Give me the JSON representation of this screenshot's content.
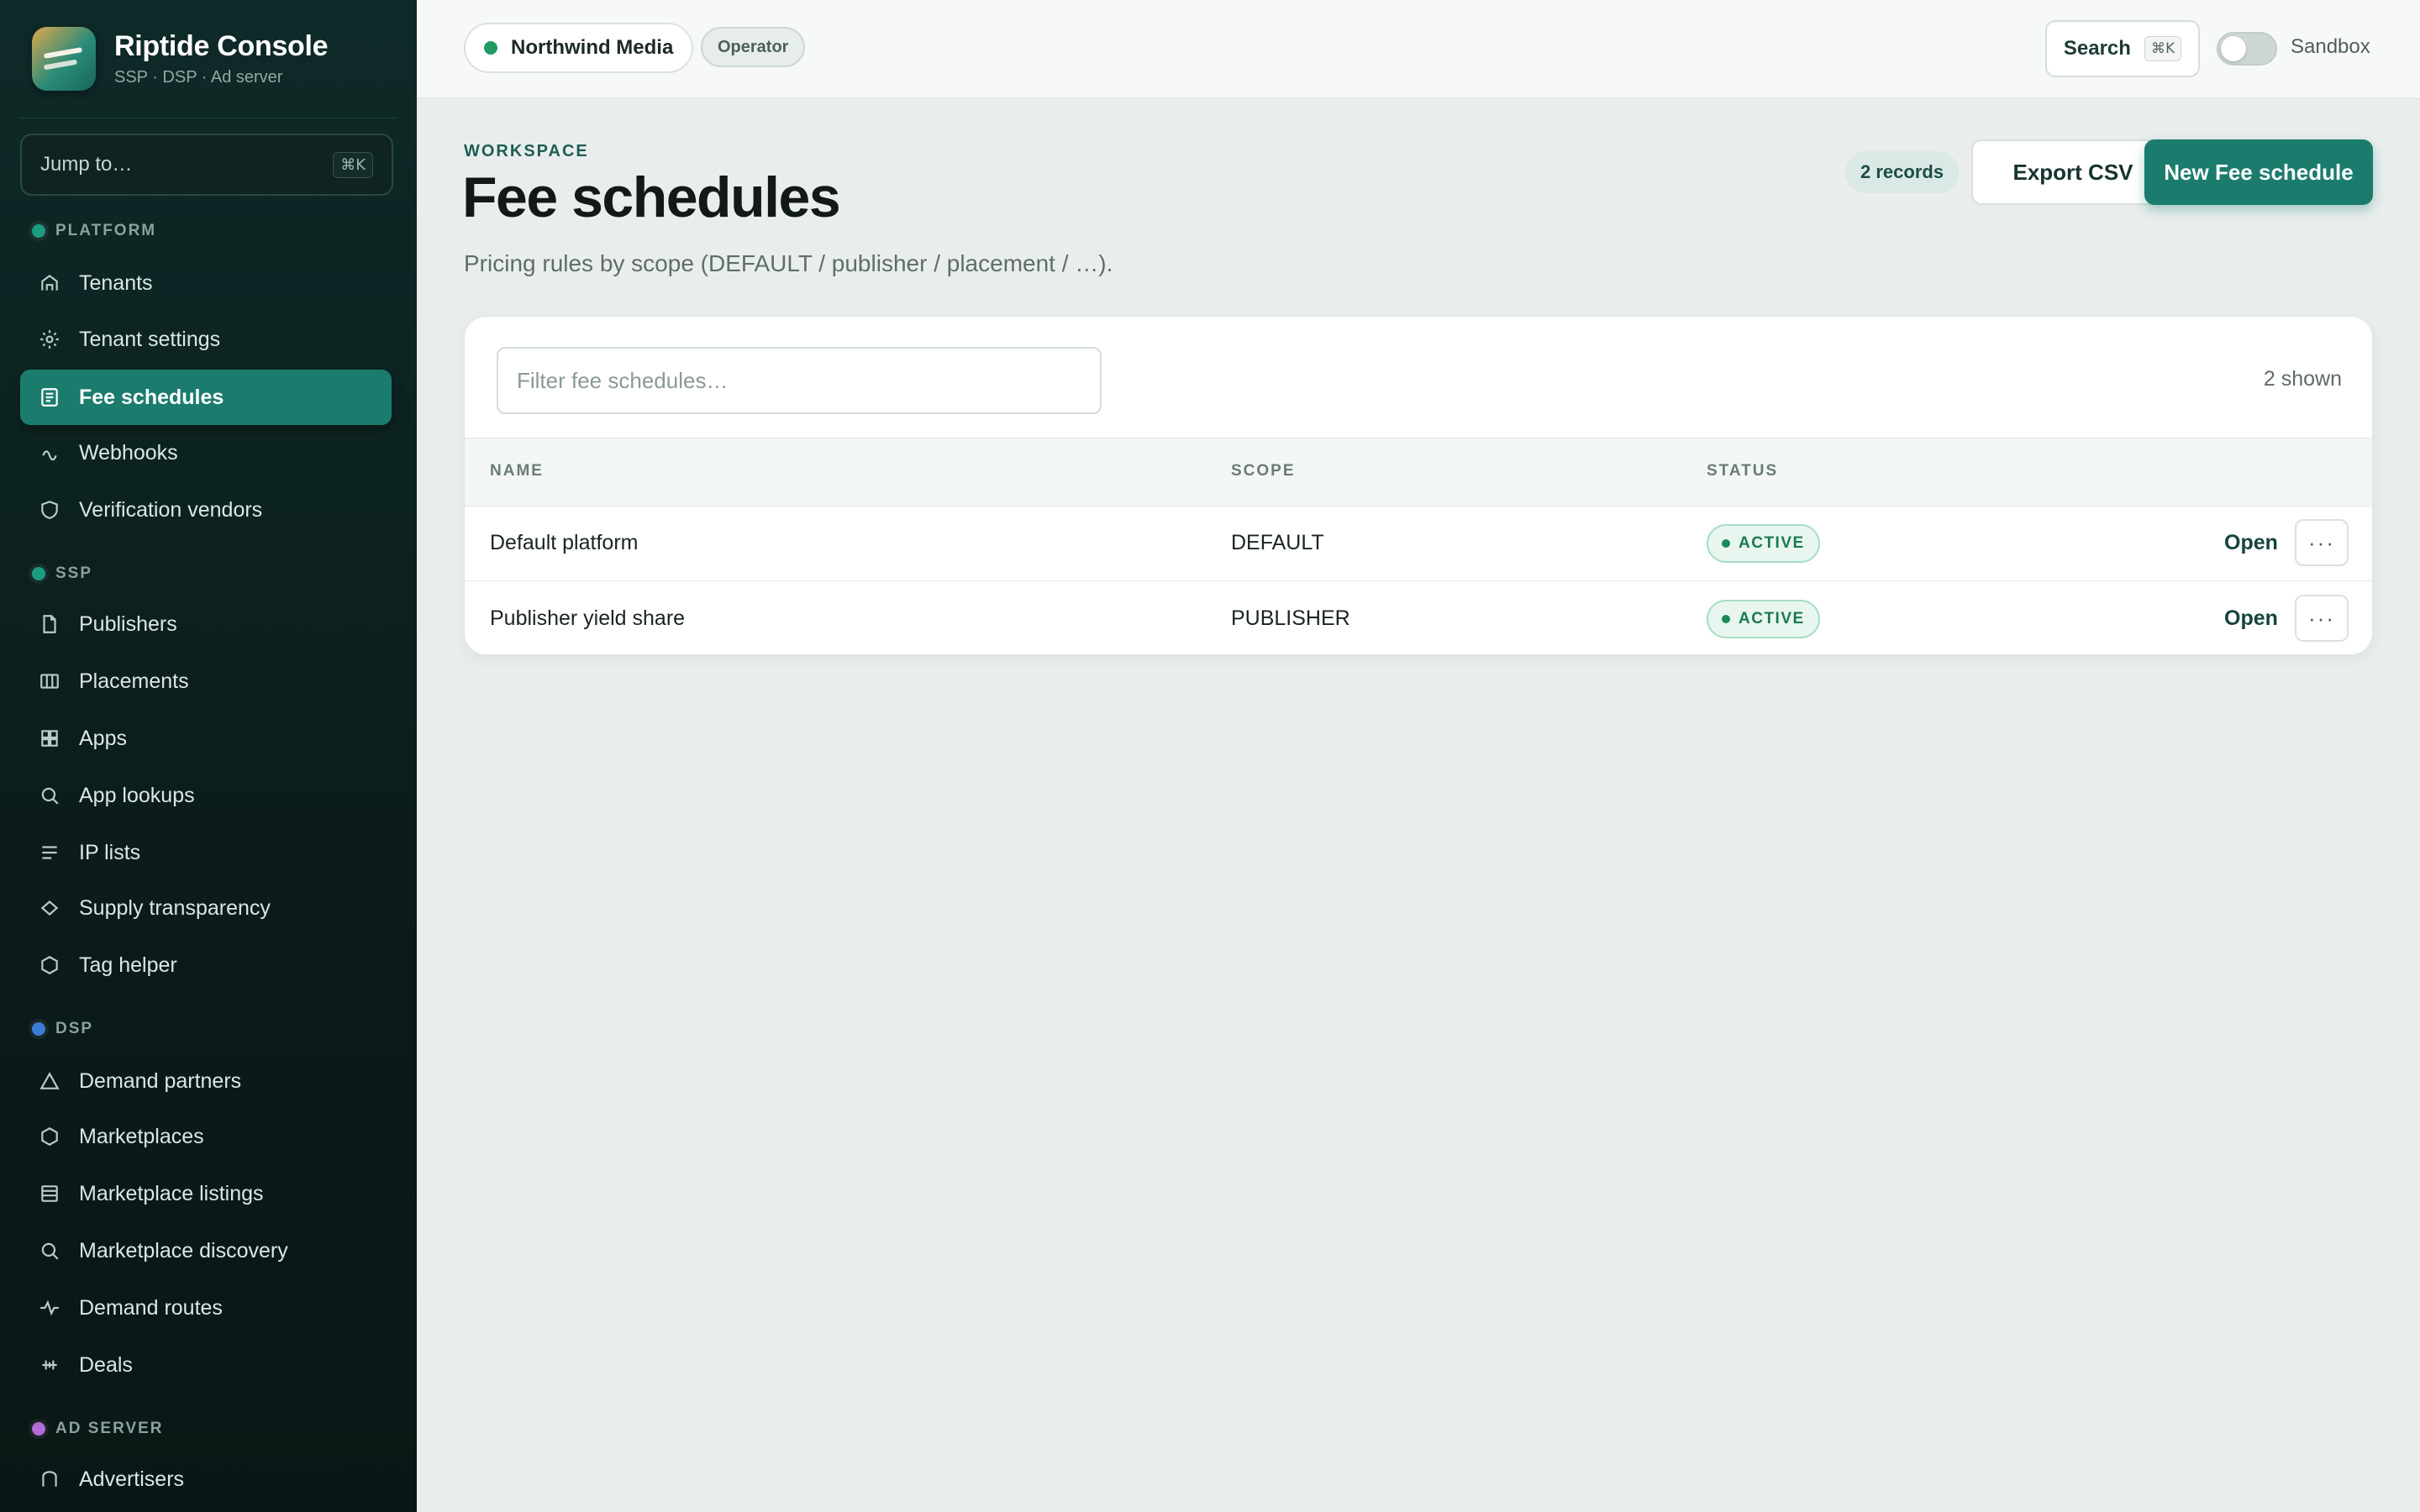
{
  "sidebar": {
    "brand_title": "Riptide Console",
    "brand_sub": "SSP · DSP · Ad server",
    "jump_label": "Jump to…",
    "jump_shortcut": "⌘K",
    "sections": [
      {
        "label": "PLATFORM",
        "color": "#1b9c80"
      },
      {
        "label": "SSP",
        "color": "#1b9c80"
      },
      {
        "label": "DSP",
        "color": "#3a7bd5"
      },
      {
        "label": "AD SERVER",
        "color": "#b36bd6"
      }
    ],
    "items": [
      {
        "label": "Tenants",
        "icon": "home-icon"
      },
      {
        "label": "Tenant settings",
        "icon": "gear-icon"
      },
      {
        "label": "Fee schedules",
        "icon": "document-icon",
        "active": true
      },
      {
        "label": "Webhooks",
        "icon": "webhook-icon"
      },
      {
        "label": "Verification vendors",
        "icon": "shield-icon"
      },
      {
        "label": "Publishers",
        "icon": "file-icon"
      },
      {
        "label": "Placements",
        "icon": "columns-icon"
      },
      {
        "label": "Apps",
        "icon": "grid-icon"
      },
      {
        "label": "App lookups",
        "icon": "search-icon"
      },
      {
        "label": "IP lists",
        "icon": "list-icon"
      },
      {
        "label": "Supply transparency",
        "icon": "diamond-icon"
      },
      {
        "label": "Tag helper",
        "icon": "hexagon-icon"
      },
      {
        "label": "Demand partners",
        "icon": "triangle-icon"
      },
      {
        "label": "Marketplaces",
        "icon": "hexagon-icon"
      },
      {
        "label": "Marketplace listings",
        "icon": "listing-icon"
      },
      {
        "label": "Marketplace discovery",
        "icon": "search-icon"
      },
      {
        "label": "Demand routes",
        "icon": "pulse-icon"
      },
      {
        "label": "Deals",
        "icon": "handshake-icon"
      },
      {
        "label": "Advertisers",
        "icon": "home-icon"
      }
    ]
  },
  "topbar": {
    "tenant": "Northwind Media",
    "role": "Operator",
    "search_label": "Search",
    "search_shortcut": "⌘K",
    "sandbox_label": "Sandbox",
    "sandbox_on": false
  },
  "header": {
    "eyebrow": "WORKSPACE",
    "title": "Fee schedules",
    "subtitle": "Pricing rules by scope (DEFAULT / publisher / placement / …).",
    "records": "2 records",
    "export_label": "Export CSV",
    "new_label": "New Fee schedule"
  },
  "table": {
    "filter_placeholder": "Filter fee schedules…",
    "shown": "2 shown",
    "columns": {
      "name": "NAME",
      "scope": "SCOPE",
      "status": "STATUS"
    },
    "open_label": "Open",
    "more_label": "···",
    "rows": [
      {
        "name": "Default platform",
        "scope": "DEFAULT",
        "status": "ACTIVE"
      },
      {
        "name": "Publisher yield share",
        "scope": "PUBLISHER",
        "status": "ACTIVE"
      }
    ]
  }
}
